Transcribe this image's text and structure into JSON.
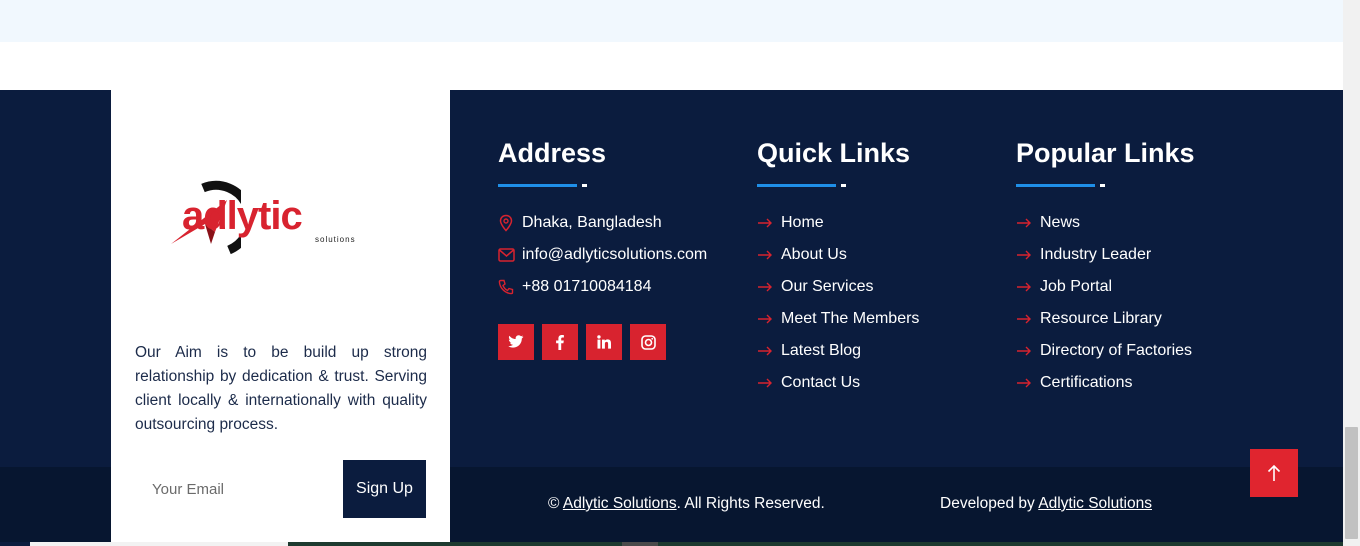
{
  "brand": {
    "logo_word": "adlytic",
    "logo_sub": "solutions",
    "aim": "Our Aim is to be build up strong relationship by dedication & trust. Serving client locally & internationally with quality outsourcing process.",
    "email_placeholder": "Your Email",
    "signup_label": "Sign Up"
  },
  "address": {
    "title": "Address",
    "items": [
      {
        "icon": "location-pin-icon",
        "text": "Dhaka, Bangladesh"
      },
      {
        "icon": "envelope-icon",
        "text": "info@adlyticsolutions.com"
      },
      {
        "icon": "phone-icon",
        "text": "+88 01710084184"
      }
    ],
    "social": [
      {
        "icon": "twitter-icon"
      },
      {
        "icon": "facebook-icon"
      },
      {
        "icon": "linkedin-icon"
      },
      {
        "icon": "instagram-icon"
      }
    ]
  },
  "quick_links": {
    "title": "Quick Links",
    "items": [
      "Home",
      "About Us",
      "Our Services",
      "Meet The Members",
      "Latest Blog",
      "Contact Us"
    ]
  },
  "popular_links": {
    "title": "Popular Links",
    "items": [
      "News",
      "Industry Leader",
      "Job Portal",
      "Resource Library",
      "Directory of Factories",
      "Certifications"
    ]
  },
  "footer": {
    "copyright_prefix": "© ",
    "copyright_link": "Adlytic Solutions",
    "copyright_suffix": ". All Rights Reserved.",
    "developed_prefix": "Developed by ",
    "developed_link": "Adlytic Solutions"
  },
  "colors": {
    "navy": "#0b1c3e",
    "accent_red": "#d8232f",
    "accent_blue": "#1f8fe8"
  }
}
